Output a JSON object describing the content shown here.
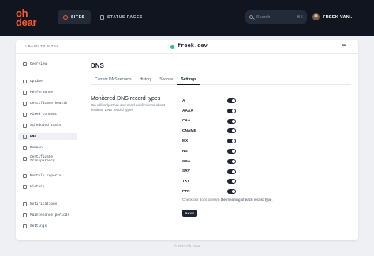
{
  "brand": {
    "line1": "oh",
    "line2": "dear",
    "color": "#ff5a2c"
  },
  "topnav": {
    "sites_label": "SITES",
    "status_pages_label": "STATUS PAGES",
    "search_placeholder": "Search",
    "search_shortcut": "⌘K",
    "user_name": "FREEK VAN..."
  },
  "header": {
    "back_label": "< BACK TO SITES",
    "site_name": "freek.dev",
    "more_label": "•••"
  },
  "sidebar": {
    "items": [
      {
        "label": "Overview",
        "icon": "grid-icon"
      },
      {
        "label": "Uptime",
        "icon": "pulse-icon"
      },
      {
        "label": "Performance",
        "icon": "gauge-icon"
      },
      {
        "label": "Certificate health",
        "icon": "lock-icon"
      },
      {
        "label": "Mixed content",
        "icon": "shield-icon"
      },
      {
        "label": "Scheduled tasks",
        "icon": "clock-icon"
      },
      {
        "label": "DNS",
        "icon": "server-icon"
      },
      {
        "label": "Domain",
        "icon": "globe-icon"
      },
      {
        "label": "Certificate transparency",
        "icon": "eye-icon"
      },
      {
        "label": "Monthly reports",
        "icon": "document-icon"
      },
      {
        "label": "History",
        "icon": "history-icon"
      },
      {
        "label": "Notifications",
        "icon": "bell-icon"
      },
      {
        "label": "Maintenance periods",
        "icon": "wrench-icon"
      },
      {
        "label": "Settings",
        "icon": "gear-icon"
      }
    ]
  },
  "main": {
    "title": "DNS",
    "tabs": [
      "Current DNS records",
      "History",
      "Snooze",
      "Settings"
    ],
    "active_tab": "Settings",
    "section_title": "Monitored DNS record types",
    "section_desc": "We will only store and send notifications about enabled DNS record types",
    "records": [
      {
        "type": "A",
        "enabled": true
      },
      {
        "type": "AAAA",
        "enabled": true
      },
      {
        "type": "CAA",
        "enabled": true
      },
      {
        "type": "CNAME",
        "enabled": true
      },
      {
        "type": "MX",
        "enabled": true
      },
      {
        "type": "NS",
        "enabled": true
      },
      {
        "type": "SOA",
        "enabled": true
      },
      {
        "type": "SRV",
        "enabled": true
      },
      {
        "type": "TXT",
        "enabled": true
      },
      {
        "type": "PTR",
        "enabled": true
      }
    ],
    "docs_prefix": "Check our docs to learn ",
    "docs_link": "the meaning of each record type",
    "docs_suffix": ".",
    "save_label": "SAVE"
  },
  "footer": "© 2022 Oh Dear",
  "colors": {
    "nav_bg": "#10151f",
    "accent": "#ff5a2c",
    "toggle_on": "#1f2533",
    "status_ok": "#2dbd8a"
  }
}
